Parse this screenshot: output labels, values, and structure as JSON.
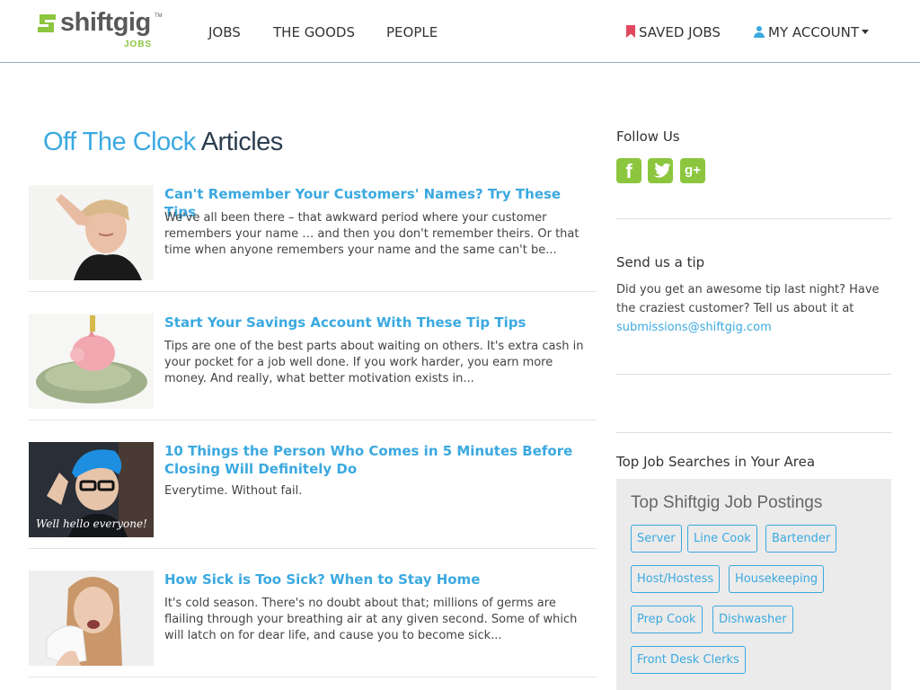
{
  "header": {
    "logo_text": "shiftgig",
    "logo_tm": "TM",
    "logo_sub": "JOBS",
    "nav": [
      "JOBS",
      "THE GOODS",
      "PEOPLE"
    ],
    "saved_jobs": "SAVED JOBS",
    "my_account": "MY ACCOUNT"
  },
  "main": {
    "title_part1": "Off The Clock",
    "title_part2": "Articles",
    "articles": [
      {
        "title": "Can't Remember Your Customers' Names? Try These Tips",
        "excerpt": "We've all been there – that awkward period where your customer remembers your name … and then you don't remember theirs. Or that time when anyone remembers your name and the same can't be..."
      },
      {
        "title": "Start Your Savings Account With These Tip Tips",
        "excerpt": "Tips are one of the best parts about waiting on others. It's extra cash in your pocket for a job well done. If you work harder, you earn more money. And really, what better motivation exists in..."
      },
      {
        "title": "10 Things the Person Who Comes in 5 Minutes Before Closing Will Definitely Do",
        "excerpt": "Everytime. Without fail.",
        "image_caption": "Well hello everyone!"
      },
      {
        "title": "How Sick is Too Sick? When to Stay Home",
        "excerpt": "It's cold season. There's no doubt about that; millions of germs are flailing through your breathing air at any given second. Some of which will latch on for dear life, and cause you to become sick..."
      }
    ]
  },
  "sidebar": {
    "follow_heading": "Follow Us",
    "social_icons": [
      "facebook-icon",
      "twitter-icon",
      "google-plus-icon"
    ],
    "tip_heading": "Send us a tip",
    "tip_text": "Did you get an awesome tip last night? Have the craziest customer? Tell us about it at",
    "tip_email": "submissions@shiftgig.com",
    "searches_heading": "Top Job Searches in Your Area",
    "postings_title": "Top Shiftgig Job Postings",
    "tags": [
      "Server",
      "Line Cook",
      "Bartender",
      "Host/Hostess",
      "Housekeeping",
      "Prep Cook",
      "Dishwasher",
      "Front Desk Clerks"
    ]
  },
  "colors": {
    "accent_blue": "#3ba9e0",
    "brand_green": "#8cc63f",
    "bookmark_red": "#e0485d"
  }
}
